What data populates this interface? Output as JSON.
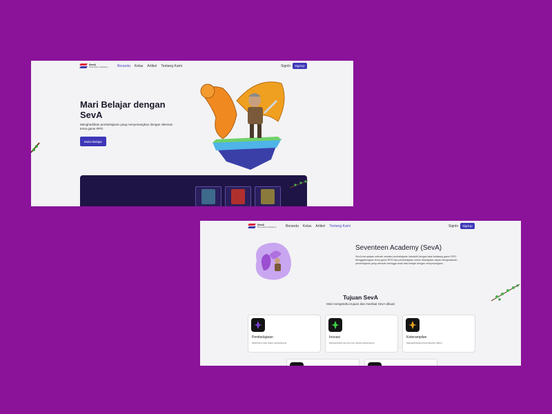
{
  "shot1": {
    "logo": {
      "name": "SevA",
      "sub": "Seventeen Academy"
    },
    "nav": [
      "Beranda",
      "Kelas",
      "Artikel",
      "Tentang Kami"
    ],
    "active_nav": 0,
    "signin": "SignIn",
    "signup": "SignUp",
    "hero": {
      "title": "Mari Belajar dengan SevA",
      "desc": "Menghadirkan pembelajaran yang menyenangkan dengan sikemas tema game RPG",
      "button": "Mulai Belajar"
    },
    "book_colors": [
      "#3e6a8c",
      "#b0302e",
      "#8a7b3c"
    ]
  },
  "shot2": {
    "logo": {
      "name": "SevA",
      "sub": "Seventeen Academy"
    },
    "nav": [
      "Beranda",
      "Kelas",
      "Artikel",
      "Tentang Kami"
    ],
    "active_nav": 3,
    "signin": "SignIn",
    "signup": "SignUp",
    "about": {
      "title": "Seventeen Academy (SevA)",
      "desc": "SevA merupakan sebuah website pembelajaran interaktif dengan latar belakang game RPG. Menggabungkan tema game RPG dan pembelajaran online diharapkan dapat menghadirkan pembelajaran yang menarik sehingga anak bisa belajar dengan menyenangkan."
    },
    "goals": {
      "title": "Tujuan SevA",
      "subtitle": "Mari mengetahui tujuan dan manfaat SevA dibuat",
      "cards": [
        {
          "title": "Pembelajaran",
          "desc": "Membantu anak dalam pembelajaran",
          "color": "#7a3fd0"
        },
        {
          "title": "Inovasi",
          "desc": "Menghadirkan inovasi baru dalam pembelajaran",
          "color": "#3fcf4a"
        },
        {
          "title": "Keterampilan",
          "desc": "Mengembangkan keterampilan digital",
          "color": "#e0a020"
        }
      ]
    }
  }
}
